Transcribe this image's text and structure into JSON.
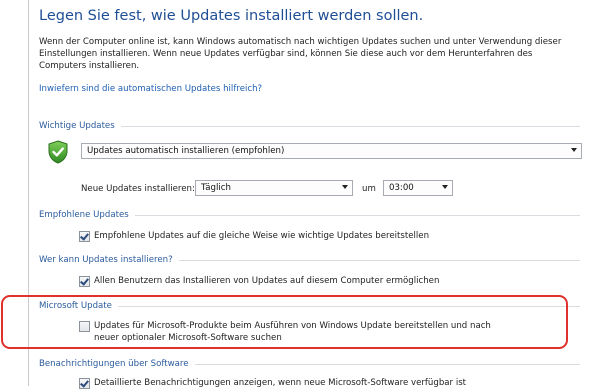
{
  "page": {
    "title": "Legen Sie fest, wie Updates installiert werden sollen.",
    "intro": "Wenn der Computer online ist, kann Windows automatisch nach wichtigen Updates suchen und unter Verwendung dieser Einstellungen installieren. Wenn neue Updates verfügbar sind, können Sie diese auch vor dem Herunterfahren des Computers installieren.",
    "help_link": "Inwiefern sind die automatischen Updates hilfreich?"
  },
  "important_updates": {
    "heading": "Wichtige Updates",
    "mode_selected": "Updates automatisch installieren (empfohlen)",
    "install_label": "Neue Updates installieren:",
    "day_selected": "Täglich",
    "at_label": "um",
    "time_selected": "03:00"
  },
  "recommended_updates": {
    "heading": "Empfohlene Updates",
    "checkbox_label": "Empfohlene Updates auf die gleiche Weise wie wichtige Updates bereitstellen",
    "checked": true
  },
  "who_can_install": {
    "heading": "Wer kann Updates installieren?",
    "checkbox_label": "Allen Benutzern das Installieren von Updates auf diesem Computer ermöglichen",
    "checked": true
  },
  "microsoft_update": {
    "heading": "Microsoft Update",
    "checkbox_label_line1": "Updates für Microsoft-Produkte beim Ausführen von Windows Update bereitstellen und nach",
    "checkbox_label_line2": "neuer optionaler Microsoft-Software suchen",
    "checked": false,
    "highlight_color": "#e0312b"
  },
  "software_notifications": {
    "heading": "Benachrichtigungen über Software",
    "checkbox_label": "Detaillierte Benachrichtigungen anzeigen, wenn neue Microsoft-Software verfügbar ist",
    "checked": true
  },
  "colors": {
    "title": "#1f4e96",
    "link": "#1e5fb4",
    "section_heading": "#2a5b9c",
    "shield": "#3f9b2f"
  },
  "icons": {
    "shield": "shield-check-icon",
    "dropdown": "chevron-down-icon"
  }
}
